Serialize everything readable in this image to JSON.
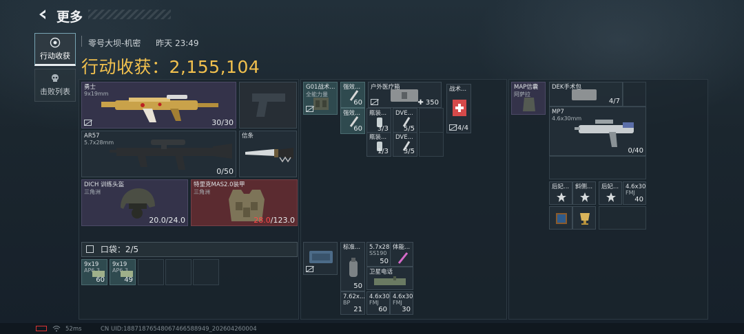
{
  "header": {
    "title": "更多"
  },
  "tabs": [
    {
      "label": "行动收获",
      "active": true
    },
    {
      "label": "击败列表",
      "active": false
    }
  ],
  "match": {
    "map": "零号大坝-机密",
    "time": "昨天 23:49"
  },
  "harvest": {
    "label": "行动收获：",
    "value": "2,155,104"
  },
  "gear": {
    "primary": {
      "name": "勇士",
      "caliber": "9x19mm",
      "ammo": "30/30"
    },
    "secondary": {
      "name": "AR57",
      "caliber": "5.7x28mm",
      "ammo": "0/50"
    },
    "melee": {
      "name": "信条"
    },
    "helmet": {
      "name": "DICH 训练头盔",
      "origin": "三角洲",
      "durability": "20.0/24.0"
    },
    "armor": {
      "name": "特里克MAS2.0装甲",
      "origin": "三角洲",
      "durability_current": "28.0",
      "durability_max": "/123.0"
    }
  },
  "pocket": {
    "label": "口袋：",
    "count": "2/5"
  },
  "pocket_items": [
    {
      "name": "9x19",
      "sub": "AP6.3",
      "count": "60"
    },
    {
      "name": "9x19",
      "sub": "AP6.3",
      "count": "49"
    }
  ],
  "chest_rig": {
    "name": "G01战术...",
    "sub": "全能力量",
    "items": [
      {
        "name": "强效...",
        "count": "60"
      },
      {
        "name": "强效...",
        "count": "60"
      },
      {
        "name": "瓶装...",
        "count": "3/3"
      },
      {
        "name": "DVE...",
        "count": "5/5"
      },
      {
        "name": "瓶装...",
        "count": "1/3"
      },
      {
        "name": "DVE...",
        "count": "3/5"
      },
      {
        "name": "户外医疗箱",
        "count": "350"
      },
      {
        "name": "战术...",
        "count": "4/4"
      }
    ]
  },
  "backpack": {
    "name": "标准...",
    "items": [
      {
        "name": "标准...",
        "count": "50"
      },
      {
        "name": "5.7x28",
        "sub": "SS190",
        "count": "50"
      },
      {
        "name": "体能...",
        "count": ""
      },
      {
        "name": "卫星电话",
        "count": ""
      },
      {
        "name": "7.62x...",
        "sub": "BP",
        "count": "21"
      },
      {
        "name": "4.6x30",
        "sub": "FMJ",
        "count": "60"
      },
      {
        "name": "4.6x30",
        "sub": "FMJ",
        "count": "30"
      }
    ]
  },
  "safe_box": {
    "name": "MAP信囊",
    "sub": "阿萨拉",
    "items": [
      {
        "name": "DEK手术包",
        "count": "4/7"
      },
      {
        "name": "MP7",
        "sub": "4.6x30mm",
        "count": "0/40"
      },
      {
        "name": "后妃...",
        "count": ""
      },
      {
        "name": "斜侧...",
        "count": ""
      },
      {
        "name": "后妃...",
        "count": ""
      },
      {
        "name": "4.6x30",
        "sub": "FMJ",
        "count": "40"
      }
    ]
  },
  "footer": {
    "ping": "52ms",
    "uid": "CN UID:18871876548067466588949_202604260004"
  },
  "colors": {
    "gold": "#f2c14e",
    "armor_red": "#ff4a4a",
    "tab_active_border": "#78a4b3"
  }
}
